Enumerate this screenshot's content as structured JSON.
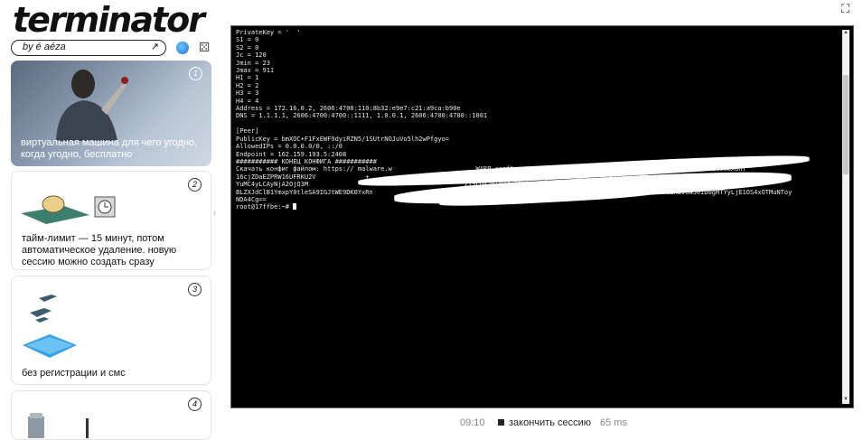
{
  "app": {
    "logo": "terminator",
    "byline": "by é aéza",
    "byline_arrow": "↗",
    "dice_icon": "⚄"
  },
  "cards": [
    {
      "num": "1",
      "text": "виртуальная машина для чего угодно,\nкогда угодно, бесплатно"
    },
    {
      "num": "2",
      "text": "тайм-лимит — 15 минут, потом\nавтоматическое удаление. новую\nсессию можно создать сразу"
    },
    {
      "num": "3",
      "text": "без регистрации и смс"
    },
    {
      "num": "4",
      "text": ""
    }
  ],
  "terminal": {
    "lines": [
      "PrivateKey = '  '  ",
      "S1 = 0",
      "S2 = 0",
      "Jc = 120",
      "Jmin = 23",
      "Jmax = 911",
      "H1 = 1",
      "H2 = 2",
      "H3 = 3",
      "H4 = 4",
      "Address = 172.16.0.2, 2606:4700:110:8b32:e9e7:c21:a9ca:b90e",
      "DNS = 1.1.1.1, 2606:4700:4700::1111, 1.0.0.1, 2606:4700:4700::1001",
      "",
      "[Peer]",
      "PublicKey = bmXOC+F1FxEWF9dyiRZN5/1SUtrNOJuVo5lh2wPfgyo=",
      "AllowedIPs = 0.0.0.0/0, ::/0",
      "Endpoint = 162.159.193.5:2408",
      "########### КОНЕЦ КОНФИГА ###########",
      "Скачать конфиг файлом: https:// malware.w                      WARP.conf&content=W0ludGVyZmFjZV0KUHJpdmF0ZUtleSA9IFZmemNHRmF1blVmeXdhT",
      "16cjZDaEZPRW16UFRKU2V             +                         3Yc3NpWgpIMyA9IDMKSDQgPSA0CkFkZHJlc3MgPSAxNzIuMT",
      "YuMC4yLCAyNjA2OjQ3M                                         ZT3cDA2NlY3JjA2OjQ3MDA6NDcwMDo6MTAwMQo=1",
      "BLZXJdClB1YmxpY0tleSA9IGJtWE9DK0YxRn                        anewW89CkFsbG93ZWRJ            eWwLjAuMC8wLCA6Oi8wCkVuZHBvaW50ID0gMTYyLjE1OS4xOTMuNToy",
      "NDA4Cg==",
      "root@17ffbe:~# "
    ]
  },
  "footer": {
    "timer": "09:10",
    "end_session": "закончить сессию",
    "ping": "65 ms"
  },
  "icons": {
    "expand": "fullscreen-icon",
    "globe": "globe-icon",
    "dice": "dice-icon"
  }
}
